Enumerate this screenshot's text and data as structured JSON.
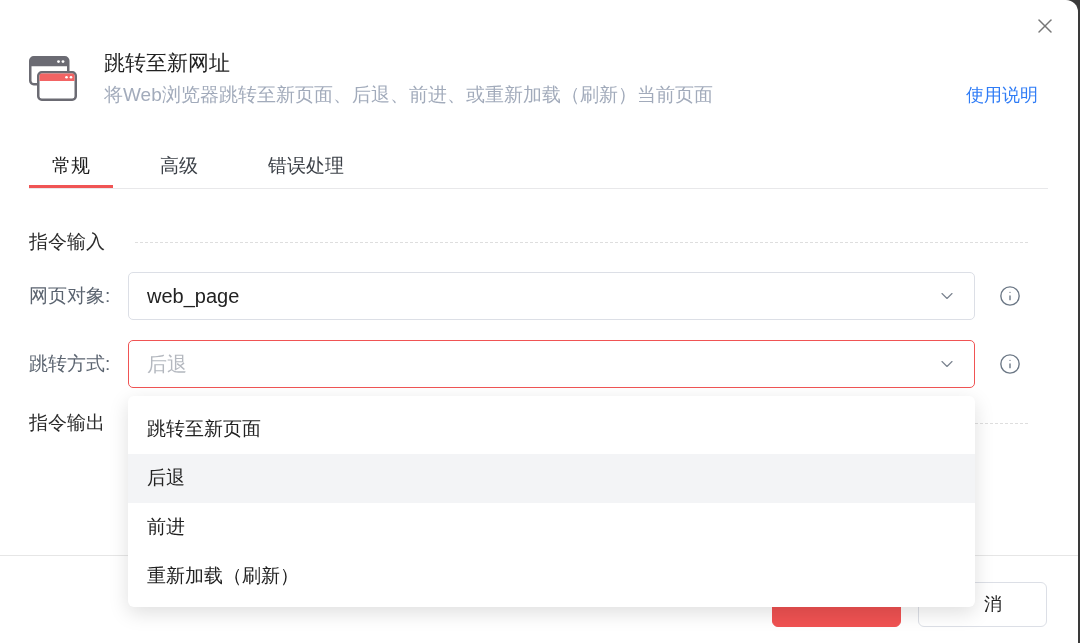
{
  "dialog": {
    "title": "跳转至新网址",
    "subtitle": "将Web浏览器跳转至新页面、后退、前进、或重新加载（刷新）当前页面",
    "help_link": "使用说明"
  },
  "tabs": [
    {
      "label": "常规",
      "selected": true
    },
    {
      "label": "高级",
      "selected": false
    },
    {
      "label": "错误处理",
      "selected": false
    }
  ],
  "sections": [
    {
      "heading": "指令输入",
      "fields": [
        {
          "label": "网页对象:",
          "value": "web_page",
          "focused": false
        },
        {
          "label": "跳转方式:",
          "placeholder": "后退",
          "focused": true,
          "open": true,
          "options": [
            {
              "label": "跳转至新页面",
              "selected": false
            },
            {
              "label": "后退",
              "selected": true
            },
            {
              "label": "前进",
              "selected": false
            },
            {
              "label": "重新加载（刷新）",
              "selected": false
            }
          ]
        }
      ]
    },
    {
      "heading": "指令输出"
    }
  ],
  "buttons": [
    {
      "kind": "primary"
    },
    {
      "label": "消",
      "kind": "default"
    }
  ]
}
